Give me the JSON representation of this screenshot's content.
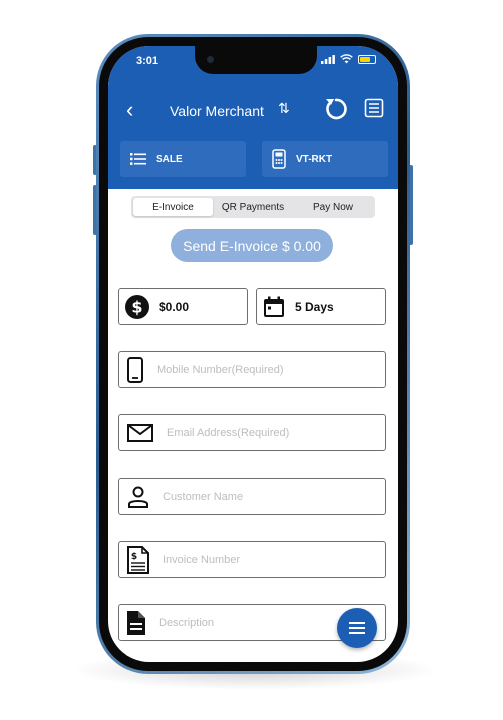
{
  "status_bar": {
    "time": "3:01"
  },
  "nav": {
    "back_glyph": "‹",
    "merchant_name": "Valor Merchant",
    "swap_glyph": "⇅"
  },
  "tiles": [
    {
      "label": "SALE",
      "icon": "list-icon"
    },
    {
      "label": "VT-RKT",
      "icon": "terminal-icon"
    }
  ],
  "tabs": [
    {
      "label": "E-Invoice",
      "active": true
    },
    {
      "label": "QR Payments",
      "active": false
    },
    {
      "label": "Pay Now",
      "active": false
    }
  ],
  "send_button": {
    "label": "Send E-Invoice $ 0.00"
  },
  "amount_field": {
    "value": "$0.00",
    "icon": "dollar-icon"
  },
  "days_field": {
    "value": "5 Days",
    "icon": "calendar-icon"
  },
  "fields": [
    {
      "placeholder": "Mobile Number(Required)",
      "icon": "phone-icon"
    },
    {
      "placeholder": "Email Address(Required)",
      "icon": "mail-icon"
    },
    {
      "placeholder": "Customer Name",
      "icon": "person-icon"
    },
    {
      "placeholder": "Invoice Number",
      "icon": "invoice-icon"
    },
    {
      "placeholder": "Description",
      "icon": "document-icon"
    }
  ],
  "colors": {
    "primary": "#1d5eb5",
    "tile": "#2f6cbd",
    "send_button": "#8fb0dc",
    "frame": "#2a5d90"
  }
}
